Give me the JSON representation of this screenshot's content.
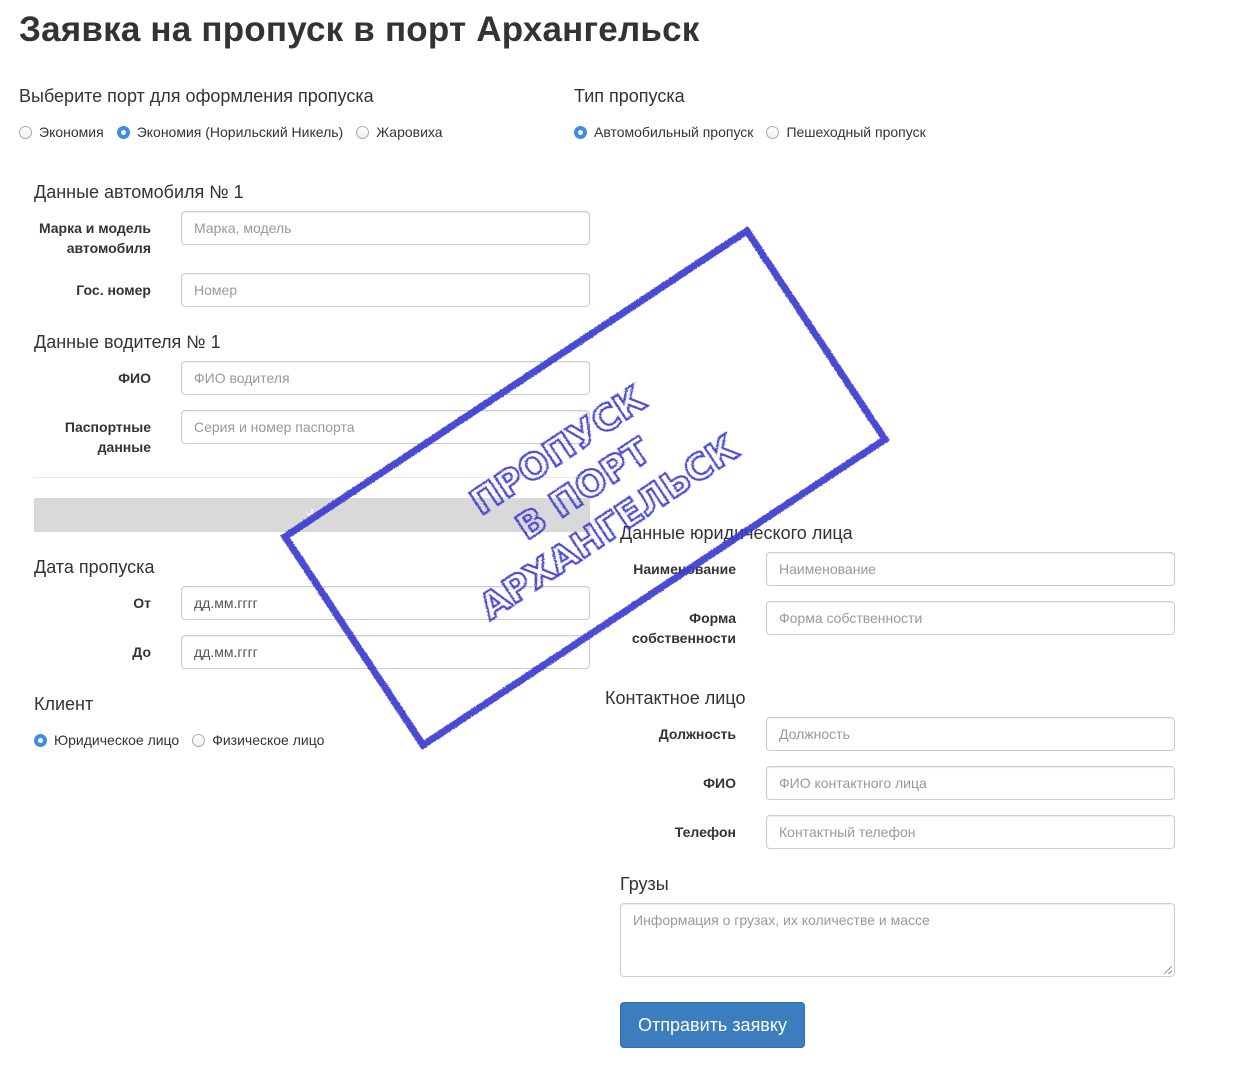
{
  "page": {
    "title": "Заявка на пропуск в порт Архангельск"
  },
  "port": {
    "heading": "Выберите порт для оформления пропуска",
    "options": [
      "Экономия",
      "Экономия (Норильский Никель)",
      "Жаровиха"
    ],
    "selected": "Экономия (Норильский Никель)"
  },
  "pass_type": {
    "heading": "Тип пропуска",
    "options": [
      "Автомобильный пропуск",
      "Пешеходный пропуск"
    ],
    "selected": "Автомобильный пропуск"
  },
  "vehicle": {
    "heading": "Данные автомобиля № 1",
    "make_label_line1": "Марка и модель",
    "make_label_line2": "автомобиля",
    "make_placeholder": "Марка, модель",
    "plate_label": "Гос. номер",
    "plate_placeholder": "Номер"
  },
  "driver": {
    "heading": "Данные водителя № 1",
    "name_label": "ФИО",
    "name_placeholder": "ФИО водителя",
    "passport_label_line1": "Паспортные",
    "passport_label_line2": "данные",
    "passport_placeholder": "Серия и номер паспорта"
  },
  "add_button": {
    "label": "+"
  },
  "pass_dates": {
    "heading": "Дата пропуска",
    "from_label": "От",
    "from_value": "дд.мм.гггг",
    "to_label": "До",
    "to_value": "дд.мм.гггг"
  },
  "client": {
    "heading": "Клиент",
    "options": [
      "Юридическое лицо",
      "Физическое лицо"
    ],
    "selected": "Юридическое лицо"
  },
  "legal_entity": {
    "heading": "Данные юридического лица",
    "name_label": "Наименование",
    "name_placeholder": "Наименование",
    "ownership_label_line1": "Форма",
    "ownership_label_line2": "собственности",
    "ownership_placeholder": "Форма собственности"
  },
  "contact": {
    "heading": "Контактное лицо",
    "position_label": "Должность",
    "position_placeholder": "Должность",
    "name_label": "ФИО",
    "name_placeholder": "ФИО контактного лица",
    "phone_label": "Телефон",
    "phone_placeholder": "Контактный телефон"
  },
  "cargo": {
    "heading": "Грузы",
    "placeholder": "Информация о грузах, их количестве и массе"
  },
  "submit": {
    "label": "Отправить заявку"
  },
  "stamp": {
    "line1": "ПРОПУСК",
    "line2": "В ПОРТ",
    "line3": "АРХАНГЕЛЬСК",
    "color": "#3a3ad0"
  }
}
